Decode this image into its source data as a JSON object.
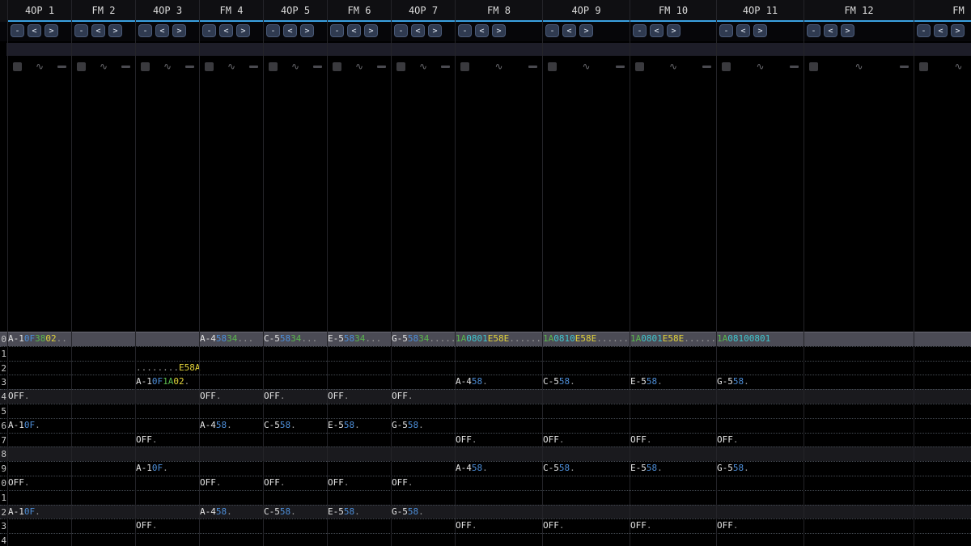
{
  "colors": {
    "accent": "#3aa0e0",
    "note": "#e4e4e4",
    "instrument": "#4d8ed8",
    "volume": "#5ab84d",
    "effect": "#e3d43a",
    "effect_value": "#40c8d0"
  },
  "channels": [
    {
      "name": "4OP 1"
    },
    {
      "name": "FM 2"
    },
    {
      "name": "4OP 3"
    },
    {
      "name": "FM 4"
    },
    {
      "name": "4OP 5"
    },
    {
      "name": "FM 6"
    },
    {
      "name": "4OP 7"
    },
    {
      "name": "FM 8"
    },
    {
      "name": "4OP 9"
    },
    {
      "name": "FM 10"
    },
    {
      "name": "4OP 11"
    },
    {
      "name": "FM 12"
    },
    {
      "name": "FM"
    }
  ],
  "channel_buttons": {
    "menu": "-",
    "prev": "<",
    "next": ">"
  },
  "channel_toggles": {
    "icons": [
      "checkbox-icon",
      "wave-icon",
      "minimize-icon"
    ],
    "wave_glyph": "∿"
  },
  "row_numbers": [
    "0",
    "1",
    "2",
    "3",
    "4",
    "5",
    "6",
    "7",
    "8",
    "9",
    "0",
    "1",
    "2",
    "3",
    "4"
  ],
  "pattern": {
    "row0": {
      "c0": [
        [
          "A-1",
          "n"
        ],
        [
          "0F",
          "i"
        ],
        [
          "38",
          "v"
        ],
        [
          "02",
          "y"
        ],
        [
          "..",
          "d"
        ]
      ],
      "c3": [
        [
          "A-4",
          "n"
        ],
        [
          "58",
          "i"
        ],
        [
          "34",
          "v"
        ],
        [
          "...",
          "d"
        ]
      ],
      "c4": [
        [
          "C-5",
          "n"
        ],
        [
          "58",
          "i"
        ],
        [
          "34",
          "v"
        ],
        [
          "...",
          "d"
        ]
      ],
      "c5": [
        [
          "E-5",
          "n"
        ],
        [
          "58",
          "i"
        ],
        [
          "34",
          "v"
        ],
        [
          "...",
          "d"
        ]
      ],
      "c6": [
        [
          "G-5",
          "n"
        ],
        [
          "58",
          "i"
        ],
        [
          "34",
          "v"
        ],
        [
          "......",
          "d"
        ]
      ],
      "c7": [
        [
          "1A",
          "v"
        ],
        [
          "08",
          "c"
        ],
        [
          "01",
          "c"
        ],
        [
          "E58E",
          "y"
        ],
        [
          "......",
          "d"
        ]
      ],
      "c8": [
        [
          "1A",
          "v"
        ],
        [
          "08",
          "c"
        ],
        [
          "10",
          "c"
        ],
        [
          "E58E",
          "y"
        ],
        [
          "......",
          "d"
        ]
      ],
      "c9": [
        [
          "1A",
          "v"
        ],
        [
          "08",
          "c"
        ],
        [
          "01",
          "c"
        ],
        [
          "E58E",
          "y"
        ],
        [
          "......",
          "d"
        ]
      ],
      "c10": [
        [
          "1A",
          "v"
        ],
        [
          "08",
          "c"
        ],
        [
          "10",
          "c"
        ],
        [
          "08",
          "c"
        ],
        [
          "01",
          "c"
        ]
      ]
    },
    "row2": {
      "c2": [
        [
          "........",
          "d"
        ],
        [
          "E58A",
          "y"
        ]
      ]
    },
    "row3": {
      "c2": [
        [
          "A-1",
          "n"
        ],
        [
          "0F",
          "i"
        ],
        [
          "1A",
          "v"
        ],
        [
          "02",
          "y"
        ],
        [
          ".",
          "d"
        ]
      ],
      "c7": [
        [
          "A-4",
          "n"
        ],
        [
          "58",
          "i"
        ],
        [
          ".",
          "d"
        ]
      ],
      "c8": [
        [
          "C-5",
          "n"
        ],
        [
          "58",
          "i"
        ],
        [
          ".",
          "d"
        ]
      ],
      "c9": [
        [
          "E-5",
          "n"
        ],
        [
          "58",
          "i"
        ],
        [
          ".",
          "d"
        ]
      ],
      "c10": [
        [
          "G-5",
          "n"
        ],
        [
          "58",
          "i"
        ],
        [
          ".",
          "d"
        ]
      ]
    },
    "row4": {
      "c0": [
        [
          "OFF",
          "n"
        ],
        [
          ".",
          "d"
        ]
      ],
      "c3": [
        [
          "OFF",
          "n"
        ],
        [
          ".",
          "d"
        ]
      ],
      "c4": [
        [
          "OFF",
          "n"
        ],
        [
          ".",
          "d"
        ]
      ],
      "c5": [
        [
          "OFF",
          "n"
        ],
        [
          ".",
          "d"
        ]
      ],
      "c6": [
        [
          "OFF",
          "n"
        ],
        [
          ".",
          "d"
        ]
      ]
    },
    "row6": {
      "c0": [
        [
          "A-1",
          "n"
        ],
        [
          "0F",
          "i"
        ],
        [
          ".",
          "d"
        ]
      ],
      "c3": [
        [
          "A-4",
          "n"
        ],
        [
          "58",
          "i"
        ],
        [
          ".",
          "d"
        ]
      ],
      "c4": [
        [
          "C-5",
          "n"
        ],
        [
          "58",
          "i"
        ],
        [
          ".",
          "d"
        ]
      ],
      "c5": [
        [
          "E-5",
          "n"
        ],
        [
          "58",
          "i"
        ],
        [
          ".",
          "d"
        ]
      ],
      "c6": [
        [
          "G-5",
          "n"
        ],
        [
          "58",
          "i"
        ],
        [
          ".",
          "d"
        ]
      ]
    },
    "row7": {
      "c2": [
        [
          "OFF",
          "n"
        ],
        [
          ".",
          "d"
        ]
      ],
      "c7": [
        [
          "OFF",
          "n"
        ],
        [
          ".",
          "d"
        ]
      ],
      "c8": [
        [
          "OFF",
          "n"
        ],
        [
          ".",
          "d"
        ]
      ],
      "c9": [
        [
          "OFF",
          "n"
        ],
        [
          ".",
          "d"
        ]
      ],
      "c10": [
        [
          "OFF",
          "n"
        ],
        [
          ".",
          "d"
        ]
      ]
    },
    "row9": {
      "c2": [
        [
          "A-1",
          "n"
        ],
        [
          "0F",
          "i"
        ],
        [
          ".",
          "d"
        ]
      ],
      "c7": [
        [
          "A-4",
          "n"
        ],
        [
          "58",
          "i"
        ],
        [
          ".",
          "d"
        ]
      ],
      "c8": [
        [
          "C-5",
          "n"
        ],
        [
          "58",
          "i"
        ],
        [
          ".",
          "d"
        ]
      ],
      "c9": [
        [
          "E-5",
          "n"
        ],
        [
          "58",
          "i"
        ],
        [
          ".",
          "d"
        ]
      ],
      "c10": [
        [
          "G-5",
          "n"
        ],
        [
          "58",
          "i"
        ],
        [
          ".",
          "d"
        ]
      ]
    },
    "row10": {
      "c0": [
        [
          "OFF",
          "n"
        ],
        [
          ".",
          "d"
        ]
      ],
      "c3": [
        [
          "OFF",
          "n"
        ],
        [
          ".",
          "d"
        ]
      ],
      "c4": [
        [
          "OFF",
          "n"
        ],
        [
          ".",
          "d"
        ]
      ],
      "c5": [
        [
          "OFF",
          "n"
        ],
        [
          ".",
          "d"
        ]
      ],
      "c6": [
        [
          "OFF",
          "n"
        ],
        [
          ".",
          "d"
        ]
      ]
    },
    "row12": {
      "c0": [
        [
          "A-1",
          "n"
        ],
        [
          "0F",
          "i"
        ],
        [
          ".",
          "d"
        ]
      ],
      "c3": [
        [
          "A-4",
          "n"
        ],
        [
          "58",
          "i"
        ],
        [
          ".",
          "d"
        ]
      ],
      "c4": [
        [
          "C-5",
          "n"
        ],
        [
          "58",
          "i"
        ],
        [
          ".",
          "d"
        ]
      ],
      "c5": [
        [
          "E-5",
          "n"
        ],
        [
          "58",
          "i"
        ],
        [
          ".",
          "d"
        ]
      ],
      "c6": [
        [
          "G-5",
          "n"
        ],
        [
          "58",
          "i"
        ],
        [
          ".",
          "d"
        ]
      ]
    },
    "row13": {
      "c2": [
        [
          "OFF",
          "n"
        ],
        [
          ".",
          "d"
        ]
      ],
      "c7": [
        [
          "OFF",
          "n"
        ],
        [
          ".",
          "d"
        ]
      ],
      "c8": [
        [
          "OFF",
          "n"
        ],
        [
          ".",
          "d"
        ]
      ],
      "c9": [
        [
          "OFF",
          "n"
        ],
        [
          ".",
          "d"
        ]
      ],
      "c10": [
        [
          "OFF",
          "n"
        ],
        [
          ".",
          "d"
        ]
      ]
    }
  }
}
